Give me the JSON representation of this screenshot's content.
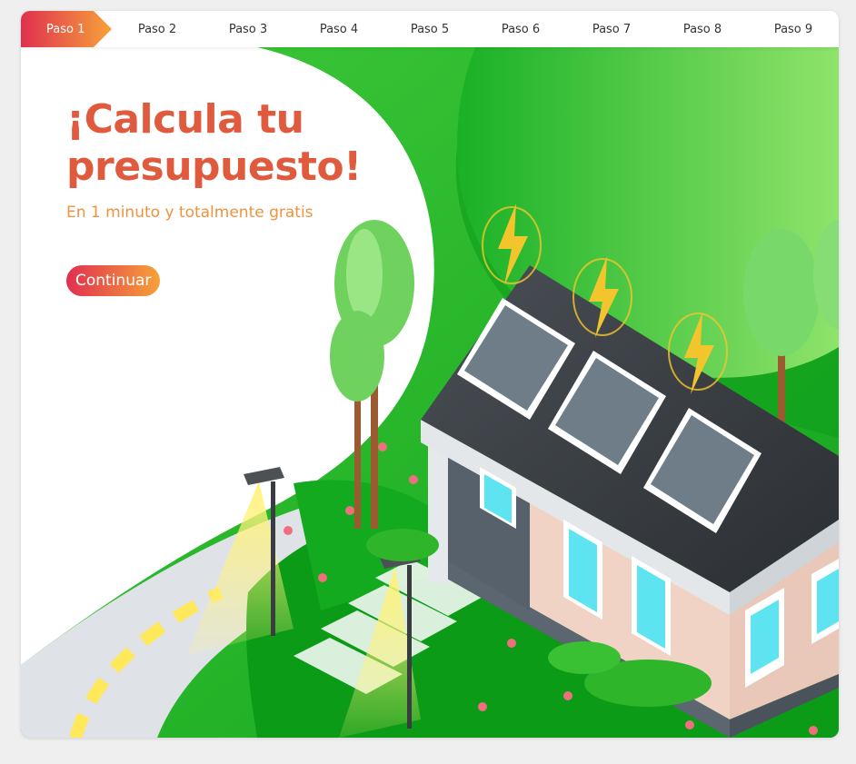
{
  "steps": [
    {
      "label": "Paso 1",
      "active": true
    },
    {
      "label": "Paso 2",
      "active": false
    },
    {
      "label": "Paso 3",
      "active": false
    },
    {
      "label": "Paso 4",
      "active": false
    },
    {
      "label": "Paso 5",
      "active": false
    },
    {
      "label": "Paso 6",
      "active": false
    },
    {
      "label": "Paso 7",
      "active": false
    },
    {
      "label": "Paso 8",
      "active": false
    },
    {
      "label": "Paso 9",
      "active": false
    }
  ],
  "hero": {
    "title_line1": "¡Calcula tu",
    "title_line2": "presupuesto!",
    "subtitle": "En 1 minuto y totalmente gratis",
    "cta_label": "Continuar"
  },
  "colors": {
    "accent_start": "#e0304f",
    "accent_end": "#f6a23a",
    "title": "#e05a3e",
    "subtitle": "#f0923e",
    "grass": "#0ea11a"
  },
  "illustration": {
    "icons": [
      "solar-panel-icon",
      "lightning-bolt-icon",
      "tree-icon",
      "street-lamp-icon",
      "flower-icon",
      "house-icon"
    ]
  }
}
